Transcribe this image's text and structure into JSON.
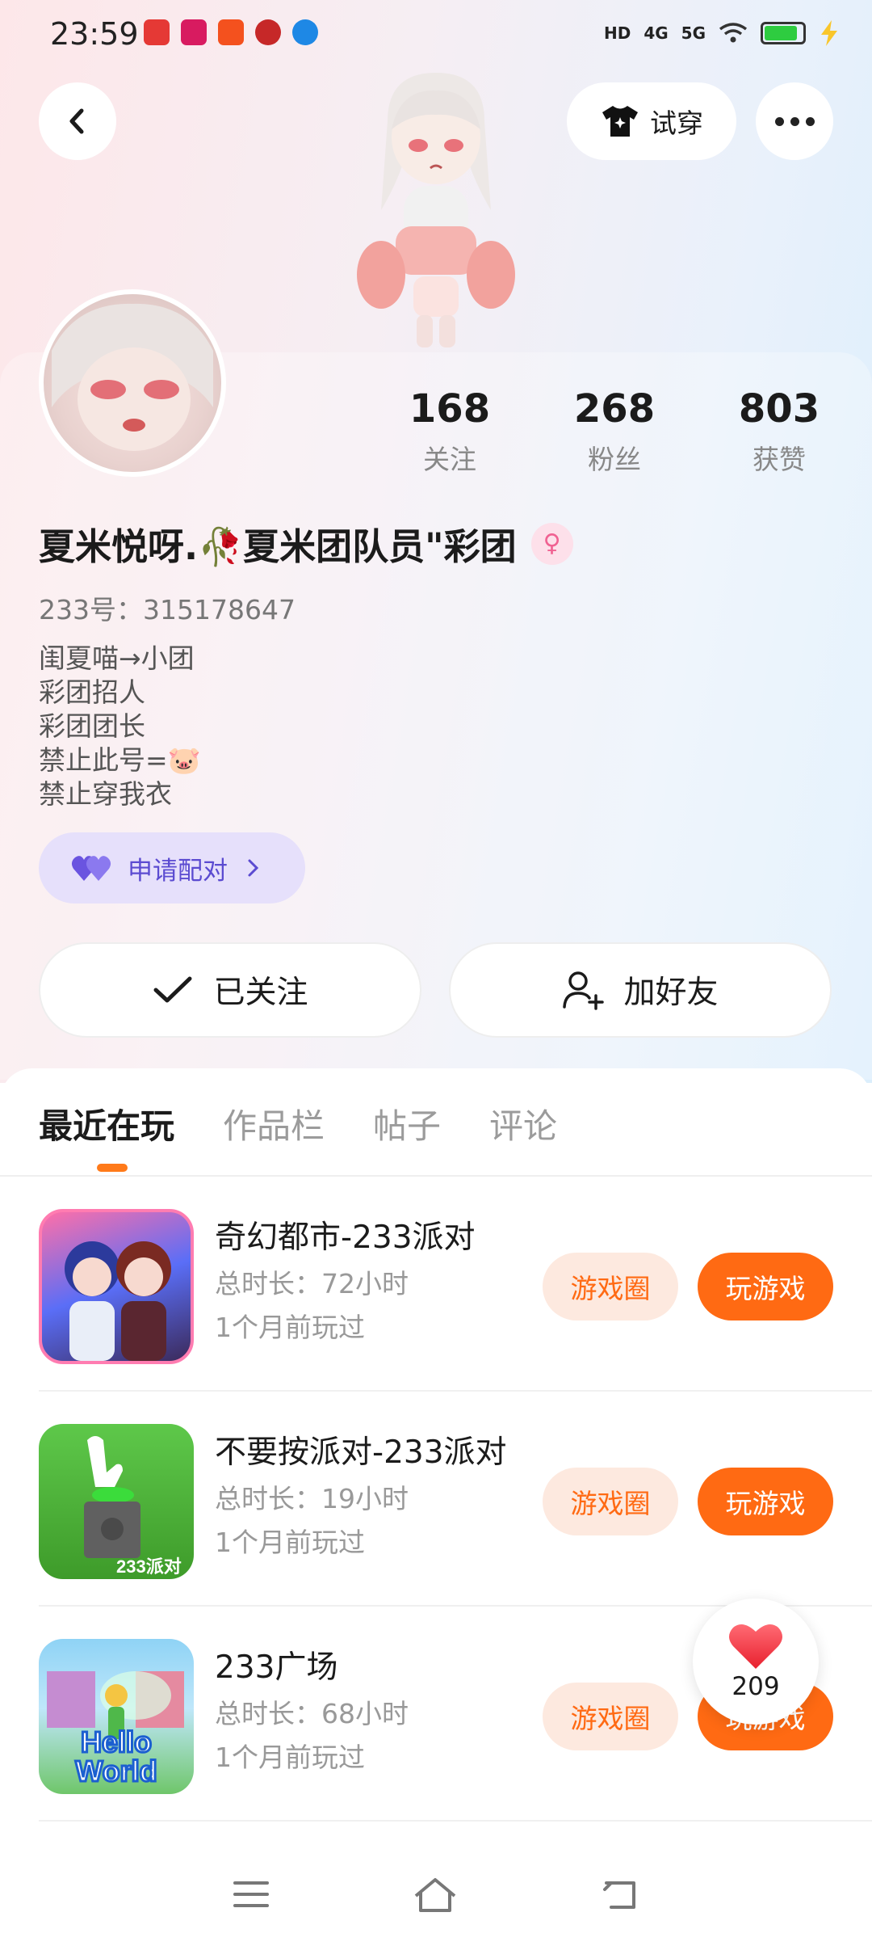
{
  "status_bar": {
    "time": "23:59",
    "hd_label": "HD",
    "sig1_label": "4G",
    "sig2_label": "5G"
  },
  "header": {
    "tryon_label": "试穿"
  },
  "stats": [
    {
      "num": "168",
      "label": "关注"
    },
    {
      "num": "268",
      "label": "粉丝"
    },
    {
      "num": "803",
      "label": "获赞"
    }
  ],
  "profile": {
    "nickname": "夏米悦呀.🥀夏米团队员\"彩团",
    "gender_icon": "♀",
    "uid": "233号：315178647",
    "bio": [
      "闺夏喵→小团",
      "彩团招人",
      "彩团团长",
      "禁止此号=🐷",
      "禁止穿我衣"
    ],
    "pair_label": "申请配对",
    "follow_label": "已关注",
    "friend_label": "加好友"
  },
  "tabs": [
    "最近在玩",
    "作品栏",
    "帖子",
    "评论"
  ],
  "games": [
    {
      "title": "奇幻都市-233派对",
      "duration": "总时长：72小时",
      "last_played": "1个月前玩过"
    },
    {
      "title": "不要按派对-233派对",
      "duration": "总时长：19小时",
      "last_played": "1个月前玩过"
    },
    {
      "title": "233广场",
      "duration": "总时长：68小时",
      "last_played": "1个月前玩过"
    }
  ],
  "game_actions": {
    "circle_label": "游戏圈",
    "play_label": "玩游戏"
  },
  "game_icon_text": {
    "icon2_badge": "233派对",
    "icon3_line1": "Hello",
    "icon3_line2": "World"
  },
  "like_float": {
    "count": "209"
  },
  "colors": {
    "accent": "#ff6a13",
    "accent_light": "#fde9df",
    "pair_purple": "#5b4bd1"
  }
}
